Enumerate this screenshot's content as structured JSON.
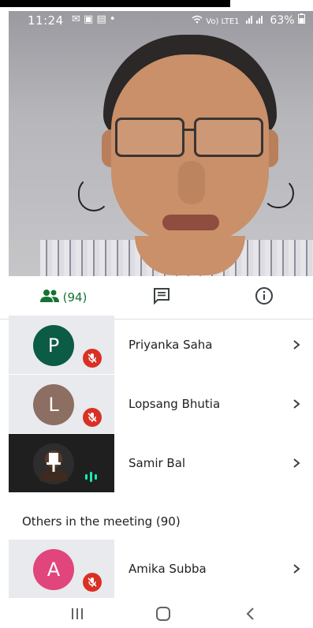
{
  "status_bar": {
    "time": "11:24",
    "left_icons": "✉ ▣ ▤ •",
    "network": "Vo) LTE1",
    "battery": "63%"
  },
  "tabs": {
    "people_count": "(94)",
    "active": "people"
  },
  "participants": [
    {
      "initial": "P",
      "name": "Priyanka Saha",
      "avatar_color": "#0b5b45",
      "muted": true
    },
    {
      "initial": "L",
      "name": "Lopsang Bhutia",
      "avatar_color": "#8d6e63",
      "muted": true
    },
    {
      "initial": "",
      "name": "Samir Bal",
      "avatar_color": "#3a3a3a",
      "muted": false,
      "speaking": true
    }
  ],
  "others_section": {
    "label": "Others in the meeting (90)"
  },
  "others": [
    {
      "initial": "A",
      "name": "Amika Subba",
      "avatar_color": "#e0457b",
      "muted": true
    }
  ],
  "colors": {
    "accent": "#137333",
    "muted_badge": "#d93025",
    "speaking": "#1de9b6"
  }
}
